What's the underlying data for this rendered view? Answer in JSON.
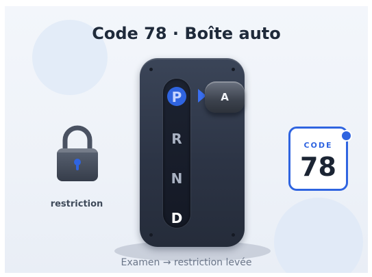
{
  "title": "Code 78 · Boîte auto",
  "lock": {
    "icon": "padlock-icon",
    "label": "restriction"
  },
  "shifter": {
    "gears": [
      "P",
      "R",
      "N",
      "D"
    ],
    "active_gear": "P",
    "knob_label": "A"
  },
  "badge": {
    "heading": "CODE",
    "number": "78"
  },
  "caption": "Examen → restriction levée",
  "colors": {
    "accent": "#2f64e0",
    "plate": "#2c3445",
    "text_dark": "#1f2a3a",
    "background": "#eef2f8"
  }
}
